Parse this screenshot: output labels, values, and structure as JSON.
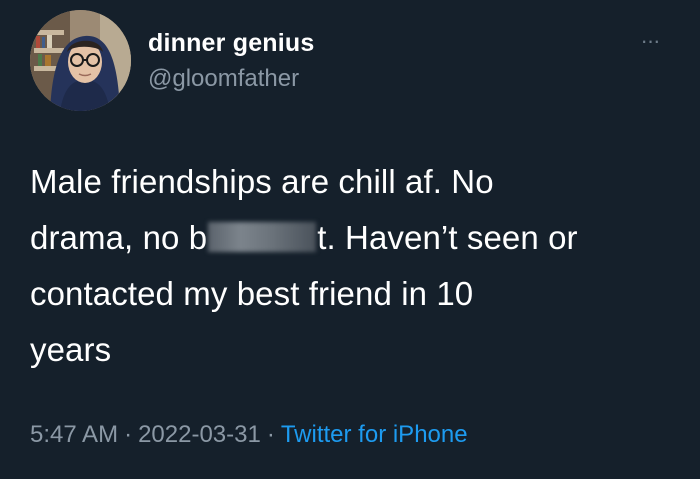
{
  "user": {
    "display_name": "dinner genius",
    "handle": "@gloomfather"
  },
  "menu": {
    "more_label": "···"
  },
  "tweet": {
    "line1": "Male friendships are chill af. No",
    "line2_before": "drama, no b",
    "line2_after": "t. Haven’t seen or",
    "line3": "contacted my best friend in 10",
    "line4": "years"
  },
  "meta": {
    "time": "5:47 AM",
    "separator": "·",
    "date": "2022-03-31",
    "source": "Twitter for iPhone"
  },
  "colors": {
    "background": "#15202b",
    "text": "#ffffff",
    "secondary_text": "#8b98a5",
    "link": "#1d9bf0"
  }
}
